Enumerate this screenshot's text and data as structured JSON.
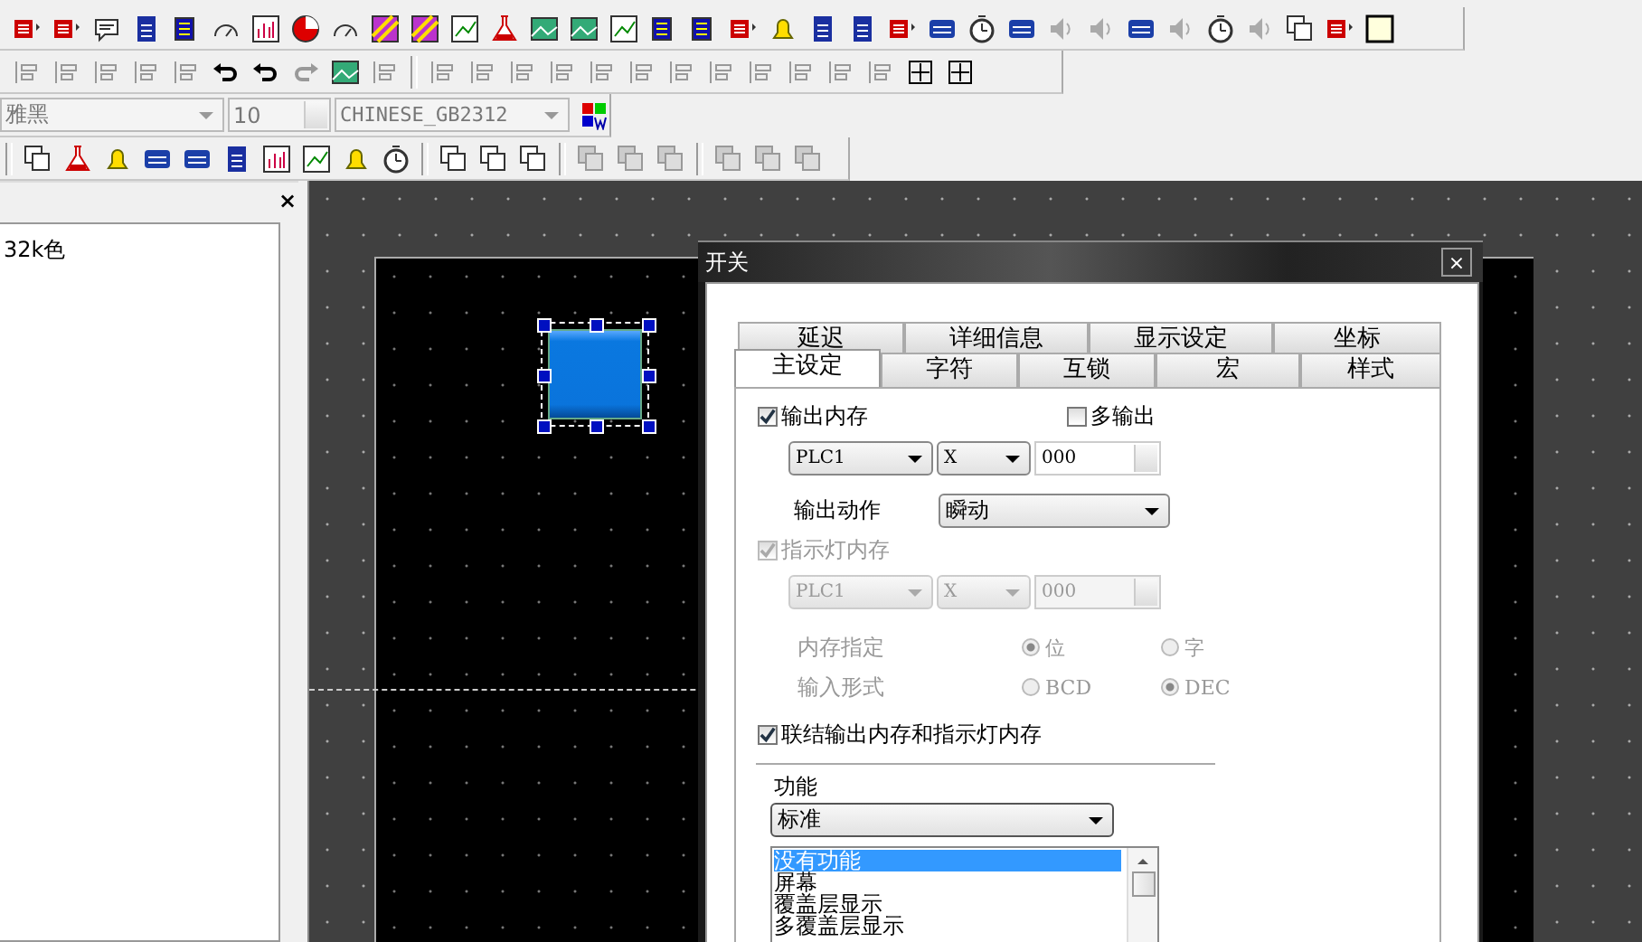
{
  "font_toolbar": {
    "font": "雅黑",
    "size": "10",
    "charset": "CHINESE_GB2312"
  },
  "left_panel": {
    "close": "×",
    "items": [
      "32k色"
    ]
  },
  "canvas": {
    "objects": [
      {
        "kind": "switch",
        "selected": true
      }
    ]
  },
  "dialog": {
    "title": "开关",
    "close": "×",
    "tabs_back": [
      {
        "label": "延迟",
        "selected": false
      },
      {
        "label": "详细信息",
        "selected": false
      },
      {
        "label": "显示设定",
        "selected": false
      },
      {
        "label": "坐标",
        "selected": false
      }
    ],
    "tabs_front": [
      {
        "label": "主设定",
        "selected": true
      },
      {
        "label": "字符",
        "selected": false
      },
      {
        "label": "互锁",
        "selected": false
      },
      {
        "label": "宏",
        "selected": false
      },
      {
        "label": "样式",
        "selected": false
      }
    ],
    "output_memory": {
      "label": "输出内存",
      "checked": true,
      "device": "PLC1",
      "address_type": "X",
      "address": "000"
    },
    "multi_output": {
      "label": "多输出",
      "checked": false
    },
    "output_action": {
      "label": "输出动作",
      "value": "瞬动"
    },
    "lamp_memory": {
      "label": "指示灯内存",
      "checked": true,
      "disabled": true,
      "device": "PLC1",
      "address_type": "X",
      "address": "000"
    },
    "memory_spec": {
      "label": "内存指定",
      "disabled": true,
      "options": [
        {
          "label": "位",
          "selected": true
        },
        {
          "label": "字",
          "selected": false
        }
      ]
    },
    "input_format": {
      "label": "输入形式",
      "disabled": true,
      "options": [
        {
          "label": "BCD",
          "selected": false
        },
        {
          "label": "DEC",
          "selected": true
        }
      ]
    },
    "link_memory": {
      "label": "联结输出内存和指示灯内存",
      "checked": true
    },
    "function": {
      "label": "功能",
      "value": "标准",
      "list": [
        {
          "label": "没有功能",
          "selected": true
        },
        {
          "label": "屏幕",
          "selected": false
        },
        {
          "label": "覆盖层显示",
          "selected": false
        },
        {
          "label": "多覆盖层显示",
          "selected": false
        }
      ]
    }
  }
}
